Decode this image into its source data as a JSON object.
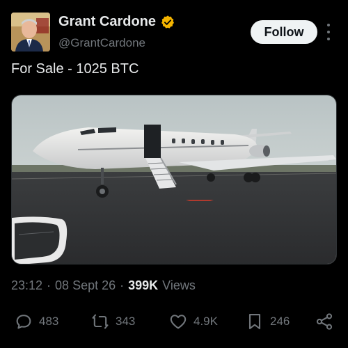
{
  "author": {
    "display_name": "Grant Cardone",
    "handle": "@GrantCardone",
    "verified": true,
    "verified_color": "#f4b400"
  },
  "follow_label": "Follow",
  "tweet": {
    "text": "For Sale - 1025 BTC",
    "media_description": "private-jet-photo"
  },
  "meta": {
    "time": "23:12",
    "sep1": "·",
    "date": "08 Sept 26",
    "sep2": "·",
    "views_count": "399K",
    "views_label": "Views"
  },
  "actions": {
    "replies": "483",
    "reposts": "343",
    "likes": "4.9K",
    "bookmarks": "246"
  },
  "icons": [
    "more-icon",
    "reply-icon",
    "repost-icon",
    "like-icon",
    "bookmark-icon",
    "share-icon",
    "verified-badge-icon"
  ]
}
